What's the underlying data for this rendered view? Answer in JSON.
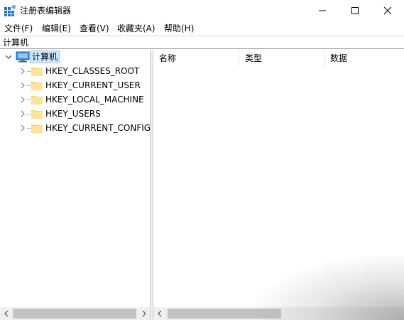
{
  "window": {
    "title": "注册表编辑器"
  },
  "menu": [
    "文件(F)",
    "编辑(E)",
    "查看(V)",
    "收藏夹(A)",
    "帮助(H)"
  ],
  "address": "计算机",
  "tree": {
    "root": "计算机",
    "children": [
      "HKEY_CLASSES_ROOT",
      "HKEY_CURRENT_USER",
      "HKEY_LOCAL_MACHINE",
      "HKEY_USERS",
      "HKEY_CURRENT_CONFIG"
    ]
  },
  "columns": {
    "name": "名称",
    "type": "类型",
    "data": "数据"
  },
  "colors": {
    "selection": "#cce8ff",
    "folder": "#f8d775",
    "scrollbar": "#f0f0f0"
  },
  "icons": {
    "app": "registry-editor-icon",
    "root": "computer-icon",
    "folder": "folder-icon",
    "expand": "chevron-right-icon",
    "collapse": "chevron-down-icon"
  }
}
